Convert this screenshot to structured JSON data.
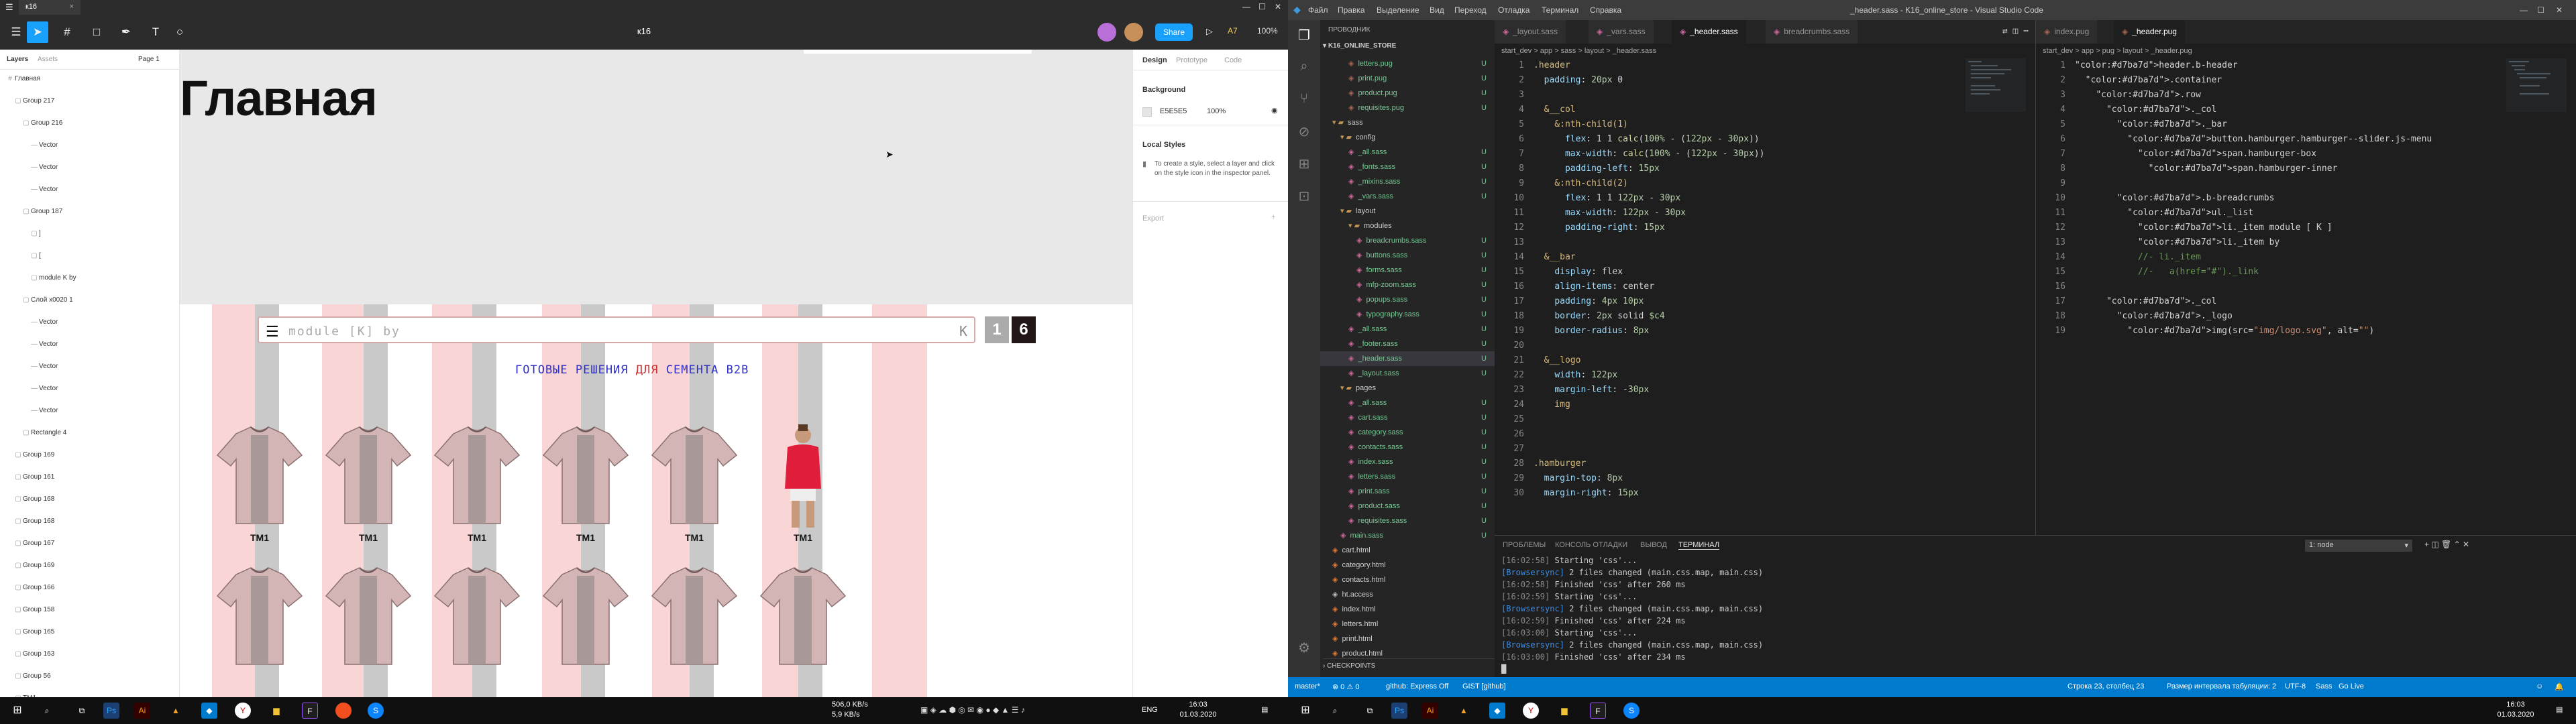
{
  "figma": {
    "file_tab": "к16",
    "title": "к16",
    "share_label": "Share",
    "play_icon": "play-icon",
    "zoom": "100%",
    "layers_tab": "Layers",
    "assets_tab": "Assets",
    "page_label": "Page 1",
    "layers": [
      {
        "label": "Главная",
        "indent": 0
      },
      {
        "label": "Group 217",
        "indent": 1
      },
      {
        "label": "Group 216",
        "indent": 2
      },
      {
        "label": "Vector",
        "indent": 3
      },
      {
        "label": "Vector",
        "indent": 3
      },
      {
        "label": "Vector",
        "indent": 3
      },
      {
        "label": "Group 187",
        "indent": 2
      },
      {
        "label": "]",
        "indent": 3
      },
      {
        "label": "[",
        "indent": 3
      },
      {
        "label": "module K by",
        "indent": 3
      },
      {
        "label": "Слой x0020 1",
        "indent": 2
      },
      {
        "label": "Vector",
        "indent": 3
      },
      {
        "label": "Vector",
        "indent": 3
      },
      {
        "label": "Vector",
        "indent": 3
      },
      {
        "label": "Vector",
        "indent": 3
      },
      {
        "label": "Vector",
        "indent": 3
      },
      {
        "label": "Rectangle 4",
        "indent": 2
      },
      {
        "label": "Group 169",
        "indent": 1
      },
      {
        "label": "Group 161",
        "indent": 1
      },
      {
        "label": "Group 168",
        "indent": 1
      },
      {
        "label": "Group 168",
        "indent": 1
      },
      {
        "label": "Group 167",
        "indent": 1
      },
      {
        "label": "Group 169",
        "indent": 1
      },
      {
        "label": "Group 166",
        "indent": 1
      },
      {
        "label": "Group 158",
        "indent": 1
      },
      {
        "label": "Group 165",
        "indent": 1
      },
      {
        "label": "Group 163",
        "indent": 1
      },
      {
        "label": "Group 56",
        "indent": 1
      },
      {
        "label": "ТМ1",
        "indent": 1
      }
    ],
    "canvas": {
      "heading": "Главная",
      "search_placeholder": "module [K] by",
      "search_k": "K",
      "logo_left": "1",
      "logo_right": "6",
      "banner_a": "ГОТОВЫЕ РЕШЕНИЯ",
      "banner_b": "ДЛЯ",
      "banner_c": "СЕМЕНТА В2В",
      "product_label": "ТМ1"
    },
    "inspector": {
      "tabs": [
        "Design",
        "Prototype",
        "Code"
      ],
      "background_title": "Background",
      "bg_hex": "E5E5E5",
      "bg_opacity": "100%",
      "local_styles_title": "Local Styles",
      "local_styles_hint": "To create a style, select a layer and click on the style icon in the inspector panel.",
      "export_title": "Export"
    }
  },
  "vscode": {
    "window_title": "_header.sass - K16_online_store - Visual Studio Code",
    "menu": [
      "Файл",
      "Правка",
      "Выделение",
      "Вид",
      "Переход",
      "Отладка",
      "Терминал",
      "Справка"
    ],
    "explorer_title": "ПРОВОДНИК",
    "project": "K16_ONLINE_STORE",
    "tree": [
      {
        "label": "letters.pug",
        "indent": 3,
        "type": "pug",
        "u": "U"
      },
      {
        "label": "print.pug",
        "indent": 3,
        "type": "pug",
        "u": "U"
      },
      {
        "label": "product.pug",
        "indent": 3,
        "type": "pug",
        "u": "U"
      },
      {
        "label": "requisites.pug",
        "indent": 3,
        "type": "pug",
        "u": "U"
      },
      {
        "label": "sass",
        "indent": 1,
        "type": "folder",
        "u": ""
      },
      {
        "label": "config",
        "indent": 2,
        "type": "folder",
        "u": ""
      },
      {
        "label": "_all.sass",
        "indent": 3,
        "type": "sass",
        "u": "U"
      },
      {
        "label": "_fonts.sass",
        "indent": 3,
        "type": "sass",
        "u": "U"
      },
      {
        "label": "_mixins.sass",
        "indent": 3,
        "type": "sass",
        "u": "U"
      },
      {
        "label": "_vars.sass",
        "indent": 3,
        "type": "sass",
        "u": "U"
      },
      {
        "label": "layout",
        "indent": 2,
        "type": "folder",
        "u": ""
      },
      {
        "label": "modules",
        "indent": 3,
        "type": "folder",
        "u": ""
      },
      {
        "label": "breadcrumbs.sass",
        "indent": 4,
        "type": "sass",
        "u": "U"
      },
      {
        "label": "buttons.sass",
        "indent": 4,
        "type": "sass",
        "u": "U"
      },
      {
        "label": "forms.sass",
        "indent": 4,
        "type": "sass",
        "u": "U"
      },
      {
        "label": "mfp-zoom.sass",
        "indent": 4,
        "type": "sass",
        "u": "U"
      },
      {
        "label": "popups.sass",
        "indent": 4,
        "type": "sass",
        "u": "U"
      },
      {
        "label": "typography.sass",
        "indent": 4,
        "type": "sass",
        "u": "U"
      },
      {
        "label": "_all.sass",
        "indent": 3,
        "type": "sass",
        "u": "U"
      },
      {
        "label": "_footer.sass",
        "indent": 3,
        "type": "sass",
        "u": "U"
      },
      {
        "label": "_header.sass",
        "indent": 3,
        "type": "sass",
        "u": "U"
      },
      {
        "label": "_layout.sass",
        "indent": 3,
        "type": "sass",
        "u": "U"
      },
      {
        "label": "pages",
        "indent": 2,
        "type": "folder",
        "u": ""
      },
      {
        "label": "_all.sass",
        "indent": 3,
        "type": "sass",
        "u": "U"
      },
      {
        "label": "cart.sass",
        "indent": 3,
        "type": "sass",
        "u": "U"
      },
      {
        "label": "category.sass",
        "indent": 3,
        "type": "sass",
        "u": "U"
      },
      {
        "label": "contacts.sass",
        "indent": 3,
        "type": "sass",
        "u": "U"
      },
      {
        "label": "index.sass",
        "indent": 3,
        "type": "sass",
        "u": "U"
      },
      {
        "label": "letters.sass",
        "indent": 3,
        "type": "sass",
        "u": "U"
      },
      {
        "label": "print.sass",
        "indent": 3,
        "type": "sass",
        "u": "U"
      },
      {
        "label": "product.sass",
        "indent": 3,
        "type": "sass",
        "u": "U"
      },
      {
        "label": "requisites.sass",
        "indent": 3,
        "type": "sass",
        "u": "U"
      },
      {
        "label": "main.sass",
        "indent": 2,
        "type": "sass",
        "u": "U"
      },
      {
        "label": "cart.html",
        "indent": 1,
        "type": "html",
        "u": ""
      },
      {
        "label": "category.html",
        "indent": 1,
        "type": "html",
        "u": ""
      },
      {
        "label": "contacts.html",
        "indent": 1,
        "type": "html",
        "u": ""
      },
      {
        "label": "ht.access",
        "indent": 1,
        "type": "file",
        "u": ""
      },
      {
        "label": "index.html",
        "indent": 1,
        "type": "html",
        "u": ""
      },
      {
        "label": "letters.html",
        "indent": 1,
        "type": "html",
        "u": ""
      },
      {
        "label": "print.html",
        "indent": 1,
        "type": "html",
        "u": ""
      },
      {
        "label": "product.html",
        "indent": 1,
        "type": "html",
        "u": ""
      }
    ],
    "checkpoints": "CHECKPOINTS",
    "left_tabs": [
      "_layout.sass",
      "_vars.sass",
      "_header.sass",
      "breadcrumbs.sass"
    ],
    "left_breadcrumb": "start_dev > app > sass > layout > _header.sass",
    "left_code": [
      ".header",
      "  padding: 20px 0",
      "",
      "  &__col",
      "    &:nth-child(1)",
      "      flex: 1 1 calc(100% - (122px - 30px))",
      "      max-width: calc(100% - (122px - 30px))",
      "      padding-left: 15px",
      "    &:nth-child(2)",
      "      flex: 1 1 122px - 30px",
      "      max-width: 122px - 30px",
      "      padding-right: 15px",
      "",
      "  &__bar",
      "    display: flex",
      "    align-items: center",
      "    padding: 4px 10px",
      "    border: 2px solid $c4",
      "    border-radius: 8px",
      "",
      "  &__logo",
      "    width: 122px",
      "    margin-left: -30px",
      "    img",
      "",
      "",
      "",
      ".hamburger",
      "  margin-top: 8px",
      "  margin-right: 15px"
    ],
    "right_tabs": [
      "index.pug",
      "_header.pug"
    ],
    "right_breadcrumb": "start_dev > app > pug > layout > _header.pug",
    "right_code": [
      "header.b-header",
      "  .container",
      "    .row",
      "      ._col",
      "        ._bar",
      "          button.hamburger.hamburger--slider.js-menu",
      "            span.hamburger-box",
      "              span.hamburger-inner",
      "",
      "        .b-breadcrumbs",
      "          ul._list",
      "            li._item module [ K ]",
      "            li._item by",
      "            //- li._item",
      "            //-   a(href=\"#\")._link",
      "",
      "      ._col",
      "        ._logo",
      "          img(src=\"img/logo.svg\", alt=\"\")"
    ],
    "panel_tabs": [
      "ПРОБЛЕМЫ",
      "КОНСОЛЬ ОТЛАДКИ",
      "ВЫВОД",
      "ТЕРМИНАЛ"
    ],
    "terminal_select": "1: node",
    "terminal": [
      {
        "t": "[16:02:58]",
        "rest": " Starting 'css'..."
      },
      {
        "t": "[Browsersync]",
        "rest": " 2 files changed (main.css.map, main.css)"
      },
      {
        "t": "[16:02:58]",
        "rest": " Finished 'css' after 260 ms"
      },
      {
        "t": "[16:02:59]",
        "rest": " Starting 'css'..."
      },
      {
        "t": "[Browsersync]",
        "rest": " 2 files changed (main.css.map, main.css)"
      },
      {
        "t": "[16:02:59]",
        "rest": " Finished 'css' after 224 ms"
      },
      {
        "t": "[16:03:00]",
        "rest": " Starting 'css'..."
      },
      {
        "t": "[Browsersync]",
        "rest": " 2 files changed (main.css.map, main.css)"
      },
      {
        "t": "[16:03:00]",
        "rest": " Finished 'css' after 234 ms"
      }
    ],
    "status": {
      "branch": "master*",
      "errors": "⊗ 0 ⚠ 0",
      "github": "github: Express Off",
      "gist": "GIST [github]",
      "position": "Строка 23, столбец 23",
      "indent": "Размер интервала табуляции: 2",
      "encoding": "UTF-8",
      "lang": "Sass",
      "golive": "Go Live"
    }
  },
  "taskbar_left": {
    "net_down": "506,0 KB/s",
    "net_up": "5,9 KB/s",
    "lang": "ENG",
    "time": "16:03",
    "date": "01.03.2020"
  },
  "taskbar_right": {
    "time": "16:03",
    "date": "01.03.2020"
  }
}
